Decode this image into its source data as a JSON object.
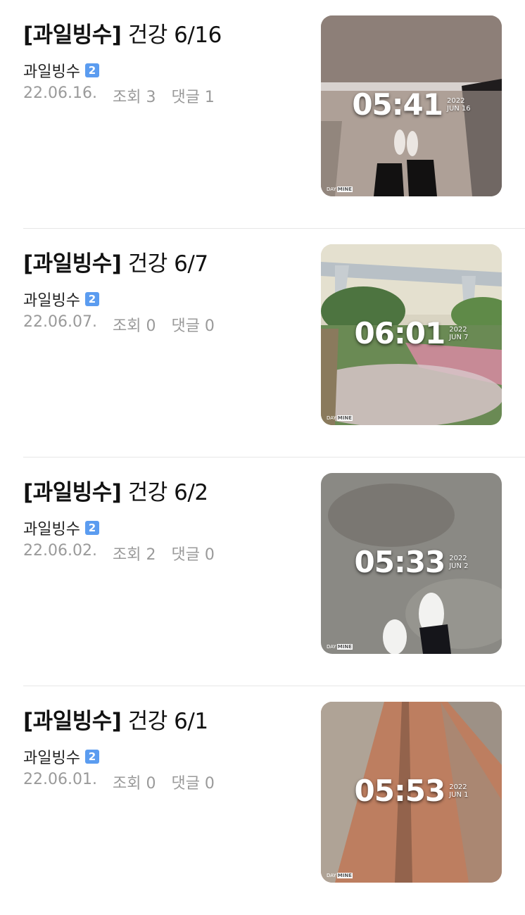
{
  "posts": [
    {
      "tag": "[과일빙수]",
      "subject": "건강 6/16",
      "author": "과일빙수",
      "badge": "2",
      "date": "22.06.16.",
      "views": "조회 3",
      "comments": "댓글 1",
      "thumb": {
        "time": "05:41",
        "year": "2022",
        "day": "JUN 16",
        "logo_a": "DAY",
        "logo_b": "MINE"
      }
    },
    {
      "tag": "[과일빙수]",
      "subject": "건강 6/7",
      "author": "과일빙수",
      "badge": "2",
      "date": "22.06.07.",
      "views": "조회 0",
      "comments": "댓글 0",
      "thumb": {
        "time": "06:01",
        "year": "2022",
        "day": "JUN 7",
        "logo_a": "DAY",
        "logo_b": "MINE"
      }
    },
    {
      "tag": "[과일빙수]",
      "subject": "건강 6/2",
      "author": "과일빙수",
      "badge": "2",
      "date": "22.06.02.",
      "views": "조회 2",
      "comments": "댓글 0",
      "thumb": {
        "time": "05:33",
        "year": "2022",
        "day": "JUN 2",
        "logo_a": "DAY",
        "logo_b": "MINE"
      }
    },
    {
      "tag": "[과일빙수]",
      "subject": "건강 6/1",
      "author": "과일빙수",
      "badge": "2",
      "date": "22.06.01.",
      "views": "조회 0",
      "comments": "댓글 0",
      "thumb": {
        "time": "05:53",
        "year": "2022",
        "day": "JUN 1",
        "logo_a": "DAY",
        "logo_b": "MINE"
      }
    }
  ]
}
